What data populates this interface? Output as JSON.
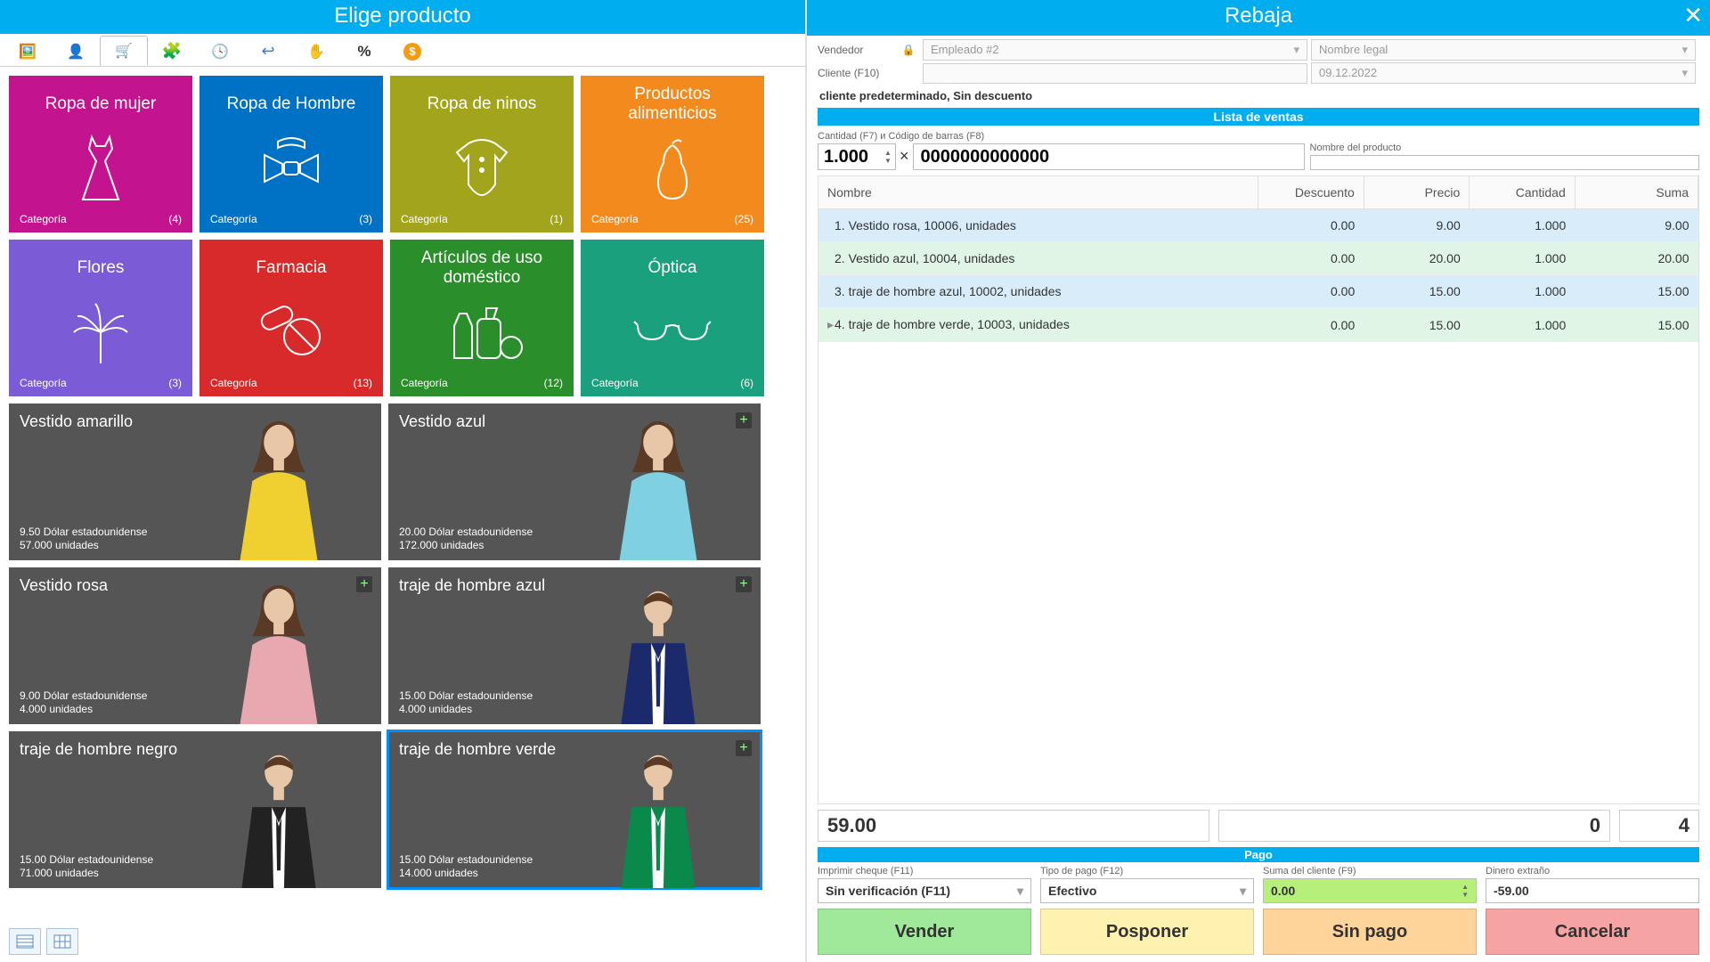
{
  "left": {
    "title": "Elige producto",
    "categories": [
      {
        "label": "Ropa de mujer",
        "foot": "Categoría",
        "count": "(4)",
        "bg": "bg-pink",
        "icon": "dress"
      },
      {
        "label": "Ropa de Hombre",
        "foot": "Categoría",
        "count": "(3)",
        "bg": "bg-blue",
        "icon": "bowtie"
      },
      {
        "label": "Ropa de ninos",
        "foot": "Categoría",
        "count": "(1)",
        "bg": "bg-olive",
        "icon": "onesie"
      },
      {
        "label": "Productos alimenticios",
        "foot": "Categoría",
        "count": "(25)",
        "bg": "bg-orange",
        "icon": "pear"
      },
      {
        "label": "Flores",
        "foot": "Categoría",
        "count": "(3)",
        "bg": "bg-purple",
        "icon": "palm"
      },
      {
        "label": "Farmacia",
        "foot": "Categoría",
        "count": "(13)",
        "bg": "bg-red",
        "icon": "pills"
      },
      {
        "label": "Artículos de uso doméstico",
        "foot": "Categoría",
        "count": "(12)",
        "bg": "bg-green",
        "icon": "cleaning"
      },
      {
        "label": "Óptica",
        "foot": "Categoría",
        "count": "(6)",
        "bg": "bg-teal",
        "icon": "glasses"
      }
    ],
    "products": [
      {
        "label": "Vestido amarillo",
        "price": "9.50 Dólar estadounidense",
        "stock": "57.000 unidades",
        "plus": false,
        "selected": false,
        "avatar": "female",
        "color": "#f0d030"
      },
      {
        "label": "Vestido azul",
        "price": "20.00 Dólar estadounidense",
        "stock": "172.000 unidades",
        "plus": true,
        "selected": false,
        "avatar": "female",
        "color": "#7fd0e0"
      },
      {
        "label": "Vestido rosa",
        "price": "9.00 Dólar estadounidense",
        "stock": "4.000 unidades",
        "plus": true,
        "selected": false,
        "avatar": "female",
        "color": "#e8a8b0"
      },
      {
        "label": "traje de hombre azul",
        "price": "15.00 Dólar estadounidense",
        "stock": "4.000 unidades",
        "plus": true,
        "selected": false,
        "avatar": "male",
        "color": "#1a2a6c"
      },
      {
        "label": "traje de hombre negro",
        "price": "15.00 Dólar estadounidense",
        "stock": "71.000 unidades",
        "plus": false,
        "selected": false,
        "avatar": "male",
        "color": "#222222"
      },
      {
        "label": "traje de hombre verde",
        "price": "15.00 Dólar estadounidense",
        "stock": "14.000 unidades",
        "plus": true,
        "selected": true,
        "avatar": "male",
        "color": "#0a8a4a"
      }
    ]
  },
  "right": {
    "title": "Rebaja",
    "seller_label": "Vendedor",
    "seller_value": "Empleado #2",
    "legal_name_ph": "Nombre legal",
    "client_label": "Cliente (F10)",
    "client_date": "09.12.2022",
    "client_info": "cliente predeterminado, Sin descuento",
    "sales_list_header": "Lista de ventas",
    "qty_label": "Cantidad (F7) и Código de barras (F8)",
    "qty_value": "1.000",
    "barcode_value": "0000000000000",
    "prodname_label": "Nombre del producto",
    "cols": {
      "name": "Nombre",
      "discount": "Descuento",
      "price": "Precio",
      "qty": "Cantidad",
      "sum": "Suma"
    },
    "rows": [
      {
        "name": "1. Vestido rosa, 10006, unidades",
        "disc": "0.00",
        "price": "9.00",
        "qty": "1.000",
        "sum": "9.00",
        "cls": "rblue"
      },
      {
        "name": "2. Vestido azul, 10004, unidades",
        "disc": "0.00",
        "price": "20.00",
        "qty": "1.000",
        "sum": "20.00",
        "cls": "rgreen"
      },
      {
        "name": "3. traje de hombre azul, 10002, unidades",
        "disc": "0.00",
        "price": "15.00",
        "qty": "1.000",
        "sum": "15.00",
        "cls": "rblue"
      },
      {
        "name": "4. traje de hombre verde, 10003, unidades",
        "disc": "0.00",
        "price": "15.00",
        "qty": "1.000",
        "sum": "15.00",
        "cls": "rgreen",
        "marker": "▸"
      }
    ],
    "totals": {
      "sum": "59.00",
      "disc": "0",
      "count": "4"
    },
    "pago_header": "Pago",
    "print_label": "Imprimir cheque (F11)",
    "print_value": "Sin verificación (F11)",
    "paytype_label": "Tipo de pago (F12)",
    "paytype_value": "Efectivo",
    "clientsum_label": "Suma del cliente (F9)",
    "clientsum_value": "0.00",
    "change_label": "Dinero extraño",
    "change_value": "-59.00",
    "btn_sell": "Vender",
    "btn_postpone": "Posponer",
    "btn_nopay": "Sin pago",
    "btn_cancel": "Cancelar"
  }
}
